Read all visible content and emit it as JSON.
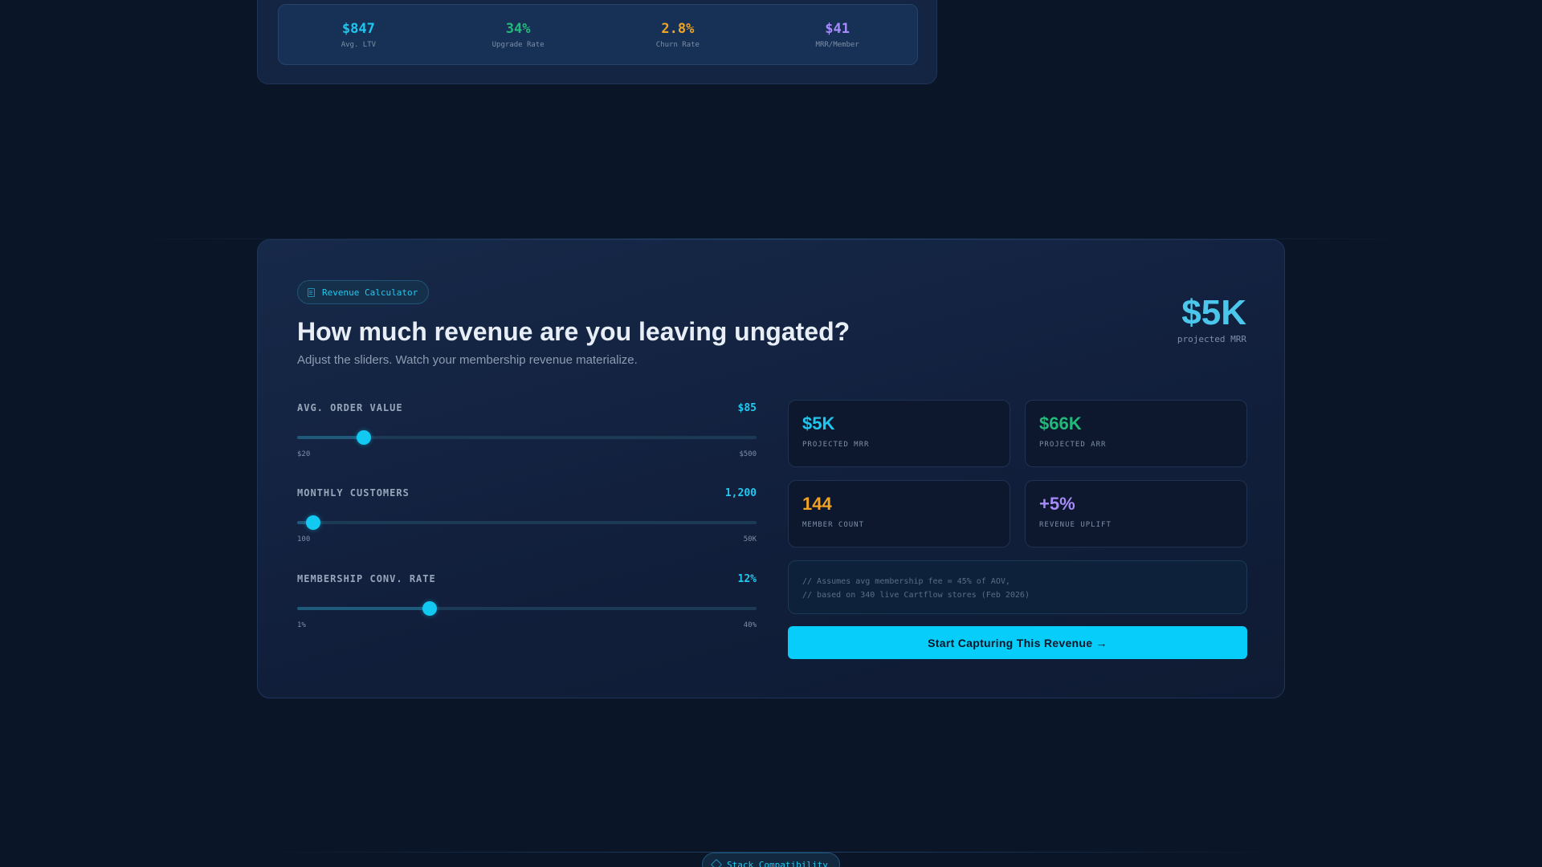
{
  "top_stats": [
    {
      "value": "$847",
      "label": "Avg. LTV",
      "color": "#1fc6ee"
    },
    {
      "value": "34%",
      "label": "Upgrade Rate",
      "color": "#22b97a"
    },
    {
      "value": "2.8%",
      "label": "Churn Rate",
      "color": "#f0a324"
    },
    {
      "value": "$41",
      "label": "MRR/Member",
      "color": "#a78bfa"
    }
  ],
  "calculator": {
    "badge": "Revenue Calculator",
    "headline": "How much revenue are you leaving ungated?",
    "subtitle": "Adjust the sliders. Watch your membership revenue materialize.",
    "projected_value": "$5K",
    "projected_label": "projected MRR",
    "sliders": [
      {
        "label": "AVG. ORDER VALUE",
        "value": "$85",
        "min": "$20",
        "max": "$500",
        "fraction": 0.145
      },
      {
        "label": "MONTHLY CUSTOMERS",
        "value": "1,200",
        "min": "100",
        "max": "50K",
        "fraction": 0.035
      },
      {
        "label": "MEMBERSHIP CONV. RATE",
        "value": "12%",
        "min": "1%",
        "max": "40%",
        "fraction": 0.288
      }
    ],
    "metrics": [
      {
        "value": "$5K",
        "label": "PROJECTED MRR",
        "color": "#1fc6ee"
      },
      {
        "value": "$66K",
        "label": "PROJECTED ARR",
        "color": "#22b97a"
      },
      {
        "value": "144",
        "label": "MEMBER COUNT",
        "color": "#f0a324"
      },
      {
        "value": "+5%",
        "label": "REVENUE UPLIFT",
        "color": "#a78bfa"
      }
    ],
    "assumption_lines": [
      "// Assumes avg membership fee = 45% of AOV,",
      "// based on 340 live Cartflow stores (Feb 2026)"
    ],
    "cta_label": "Start Capturing This Revenue →"
  },
  "stack_pill": "Stack Compatibility"
}
